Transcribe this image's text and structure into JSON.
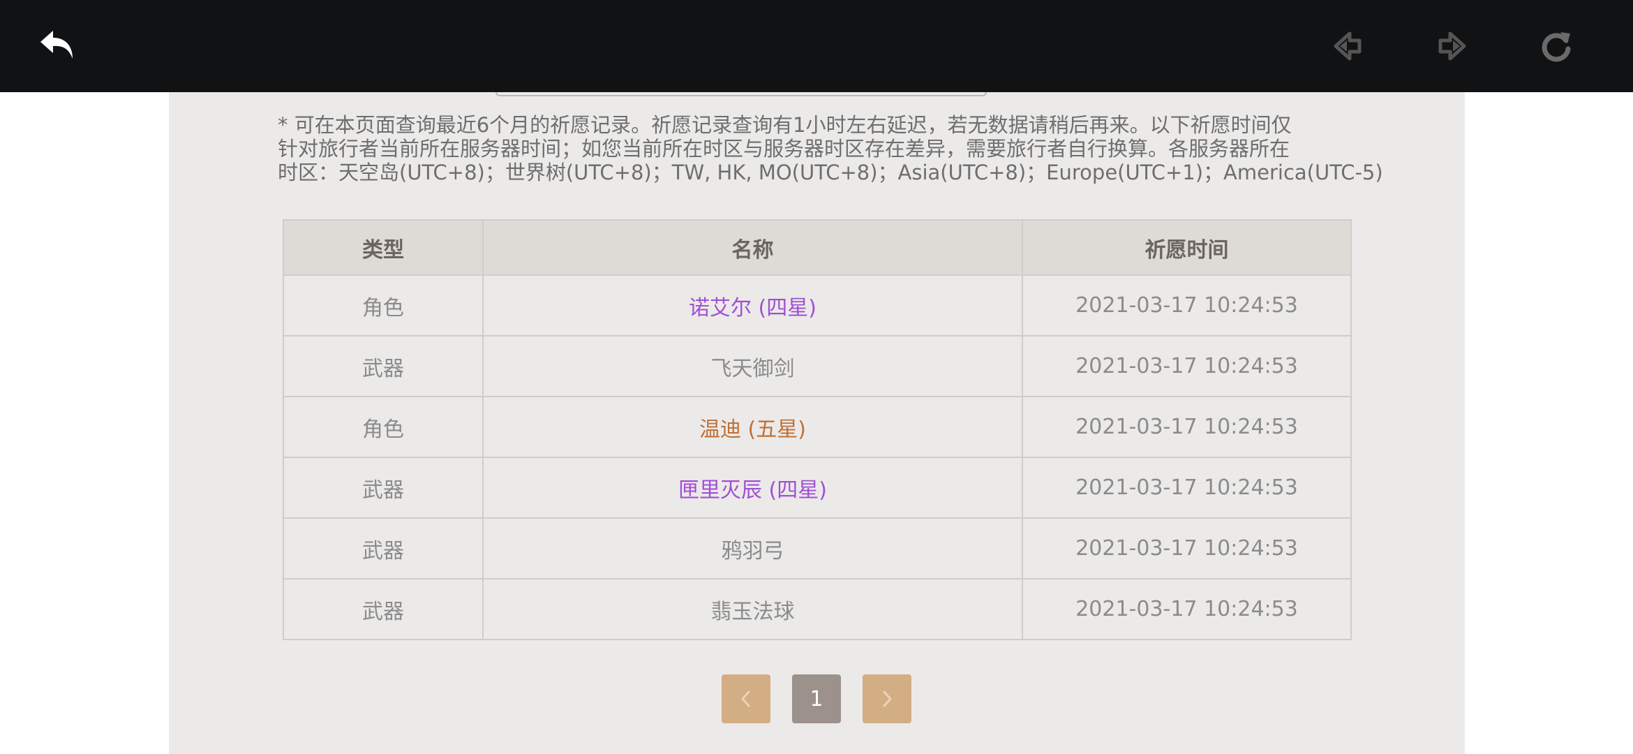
{
  "toolbar": {
    "back_icon": "back-arrow-icon",
    "nav_back_icon": "previous-page-icon",
    "nav_forward_icon": "next-page-icon",
    "refresh_icon": "refresh-icon",
    "background": "#111214"
  },
  "notice": {
    "line1": "* 可在本页面查询最近6个月的祈愿记录。祈愿记录查询有1小时左右延迟，若无数据请稍后再来。以下祈愿时间仅",
    "line2": "针对旅行者当前所在服务器时间；如您当前所在时区与服务器时区存在差异，需要旅行者自行换算。各服务器所在",
    "line3": "时区：天空岛(UTC+8)；世界树(UTC+8)；TW, HK, MO(UTC+8)；Asia(UTC+8)；Europe(UTC+1)；America(UTC-5)"
  },
  "table": {
    "headers": [
      "类型",
      "名称",
      "祈愿时间"
    ],
    "rows": [
      {
        "type": "角色",
        "name": "诺艾尔 (四星)",
        "time": "2021-03-17 10:24:53",
        "rarity": "4"
      },
      {
        "type": "武器",
        "name": "飞天御剑",
        "time": "2021-03-17 10:24:53",
        "rarity": "3"
      },
      {
        "type": "角色",
        "name": "温迪 (五星)",
        "time": "2021-03-17 10:24:53",
        "rarity": "5"
      },
      {
        "type": "武器",
        "name": "匣里灭辰 (四星)",
        "time": "2021-03-17 10:24:53",
        "rarity": "4"
      },
      {
        "type": "武器",
        "name": "鸦羽弓",
        "time": "2021-03-17 10:24:53",
        "rarity": "3"
      },
      {
        "type": "武器",
        "name": "翡玉法球",
        "time": "2021-03-17 10:24:53",
        "rarity": "3"
      }
    ]
  },
  "pagination": {
    "prev_icon": "chevron-left-icon",
    "current_page": "1",
    "next_icon": "chevron-right-icon"
  },
  "colors": {
    "four_star": "#a14fd4",
    "five_star": "#c07035",
    "three_star": "#8b8b8b",
    "pager_nav": "#d3ad83",
    "pager_current": "#9c918b"
  }
}
